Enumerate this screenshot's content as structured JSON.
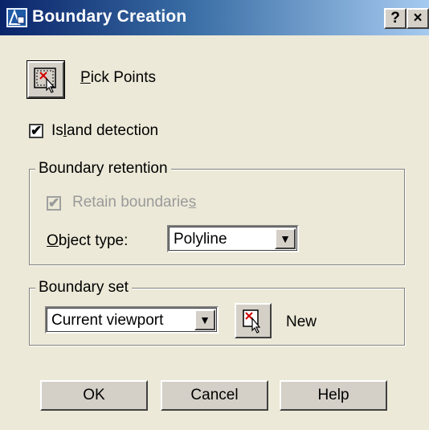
{
  "window": {
    "title": "Boundary Creation",
    "help_glyph": "?",
    "close_glyph": "×"
  },
  "pick_points": {
    "label_mnemonic": "P",
    "label_rest": "ick Points",
    "icon": "pick-points-icon"
  },
  "island_detection": {
    "checked": true,
    "label_pre": "Is",
    "label_mnemonic": "l",
    "label_post": "and detection"
  },
  "boundary_retention": {
    "legend": "Boundary retention",
    "retain": {
      "checked": true,
      "disabled": true,
      "label_pre": "Retain boundarie",
      "label_mnemonic": "s"
    },
    "object_type": {
      "label_mnemonic": "O",
      "label_rest": "bject type:",
      "value": "Polyline"
    }
  },
  "boundary_set": {
    "legend": "Boundary set",
    "value": "Current viewport",
    "new_label": "New",
    "new_icon": "select-objects-icon"
  },
  "buttons": {
    "ok": "OK",
    "cancel": "Cancel",
    "help": "Help"
  },
  "glyphs": {
    "check": "✔",
    "dropdown": "▼"
  },
  "colors": {
    "dialog_bg": "#ece9d8",
    "title_start": "#0a246a",
    "title_end": "#a6caf0",
    "disabled_text": "#9a9a9a"
  }
}
